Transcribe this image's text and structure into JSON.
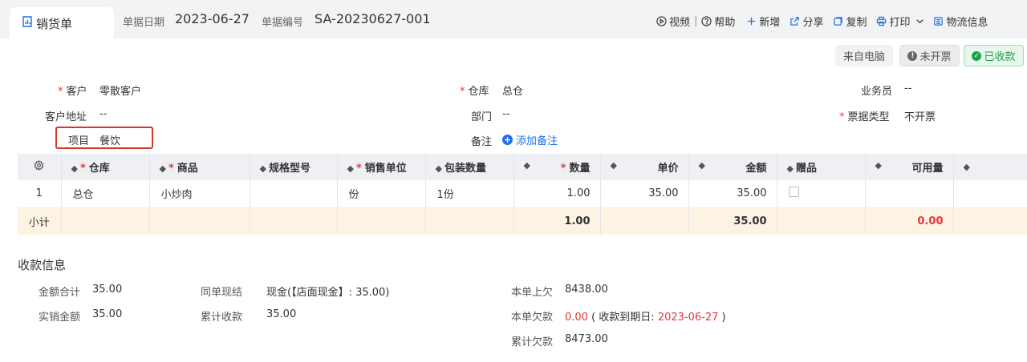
{
  "tab": {
    "title": "销货单",
    "icon": "chart-doc-icon"
  },
  "meta": {
    "date_label": "单据日期",
    "date_value": "2023-06-27",
    "number_label": "单据编号",
    "number_value": "SA-20230627-001"
  },
  "actions": {
    "video": "视频",
    "help": "帮助",
    "add": "新增",
    "share": "分享",
    "copy": "复制",
    "print": "打印",
    "logistics": "物流信息"
  },
  "badges": {
    "source": "来自电脑",
    "invoice": "未开票",
    "paid": "已收款"
  },
  "form": {
    "customer_label": "客户",
    "customer_value": "零散客户",
    "warehouse_label": "仓库",
    "warehouse_value": "总仓",
    "salesperson_label": "业务员",
    "salesperson_value": "--",
    "address_label": "客户地址",
    "address_value": "--",
    "dept_label": "部门",
    "dept_value": "--",
    "invoice_type_label": "票据类型",
    "invoice_type_value": "不开票",
    "project_label": "项目",
    "project_value": "餐饮",
    "note_label": "备注",
    "note_add": "添加备注"
  },
  "table": {
    "headers": {
      "warehouse": "仓库",
      "product": "商品",
      "spec": "规格型号",
      "unit": "销售单位",
      "pack_qty": "包装数量",
      "qty": "数量",
      "price": "单价",
      "amount": "金额",
      "gift": "赠品",
      "available": "可用量"
    },
    "rows": [
      {
        "index": "1",
        "warehouse": "总仓",
        "product": "小炒肉",
        "spec": "",
        "unit": "份",
        "pack_qty": "1份",
        "qty": "1.00",
        "price": "35.00",
        "amount": "35.00",
        "available": ""
      }
    ],
    "subtotal": {
      "label": "小计",
      "qty": "1.00",
      "amount": "35.00",
      "available": "0.00"
    }
  },
  "payment": {
    "title": "收款信息",
    "total_label": "金额合计",
    "total_value": "35.00",
    "actual_label": "实销金额",
    "actual_value": "35.00",
    "settle_label": "同单现结",
    "settle_value": "现金(【店面现金】: 35.00)",
    "cum_recv_label": "累计收款",
    "cum_recv_value": "35.00",
    "prev_owe_label": "本单上欠",
    "prev_owe_value": "8438.00",
    "cur_owe_label": "本单欠款",
    "cur_owe_value": "0.00",
    "due_prefix": "( 收款到期日:",
    "due_date": "2023-06-27",
    "due_suffix": ")",
    "cum_owe_label": "累计欠款",
    "cum_owe_value": "8473.00"
  },
  "colors": {
    "accent": "#1e6fe8",
    "danger": "#e53935",
    "success": "#1aa34a",
    "subtotal_bg": "#fdf3e3"
  }
}
